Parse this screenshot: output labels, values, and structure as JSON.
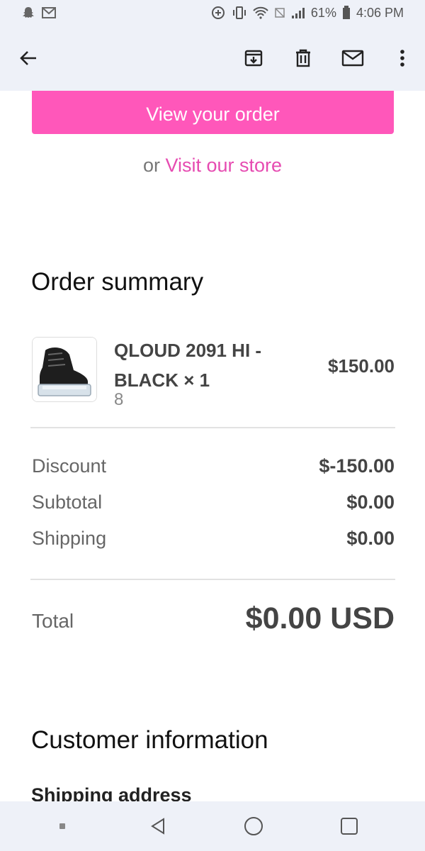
{
  "status_bar": {
    "battery": "61%",
    "time": "4:06 PM",
    "icons": [
      "snapchat-icon",
      "gmail-icon",
      "data-saver-icon",
      "vibrate-icon",
      "wifi-icon",
      "no-sim-icon",
      "signal-icon",
      "battery-icon"
    ]
  },
  "app_bar": {
    "icons": [
      "back-arrow-icon",
      "archive-icon",
      "delete-icon",
      "mail-icon",
      "more-vert-icon"
    ]
  },
  "email": {
    "cta_label": "View your order",
    "store_prefix": "or",
    "store_link": "Visit our store",
    "order_summary_title": "Order summary",
    "product": {
      "name": "QLOUD 2091 HI - BLACK × 1",
      "variant": "8",
      "price": "$150.00"
    },
    "summary": {
      "discount_label": "Discount",
      "discount_value": "$-150.00",
      "subtotal_label": "Subtotal",
      "subtotal_value": "$0.00",
      "shipping_label": "Shipping",
      "shipping_value": "$0.00"
    },
    "total_label": "Total",
    "total_value": "$0.00 USD",
    "customer_info_title": "Customer information",
    "shipping_address_heading": "Shipping address"
  },
  "colors": {
    "accent": "#ff57ba",
    "link": "#e64bb1",
    "bars": "#eef1f8"
  }
}
